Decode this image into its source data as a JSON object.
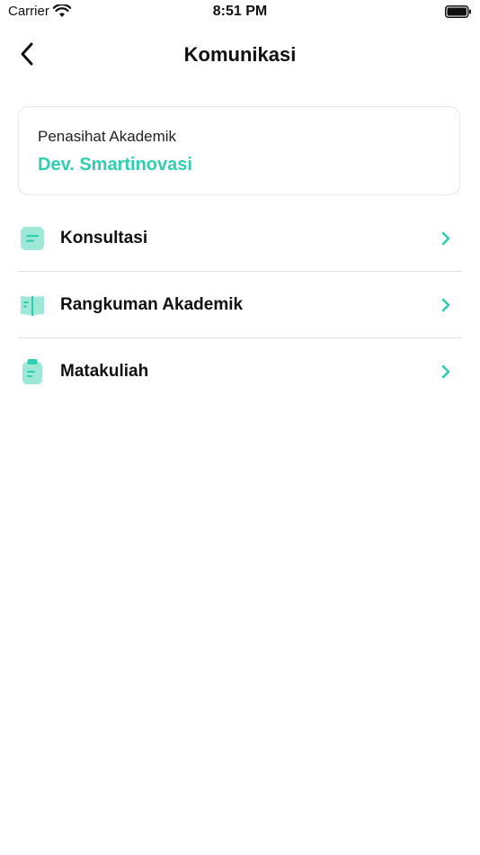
{
  "status_bar": {
    "carrier": "Carrier",
    "time": "8:51 PM",
    "icons": [
      "wifi-icon",
      "battery-icon"
    ]
  },
  "header": {
    "title": "Komunikasi",
    "back_icon": "chevron-left-icon"
  },
  "advisor_card": {
    "label": "Penasihat Akademik",
    "name": "Dev. Smartinovasi"
  },
  "menu": {
    "items": [
      {
        "label": "Konsultasi",
        "icon": "chat-icon"
      },
      {
        "label": "Rangkuman Akademik",
        "icon": "book-icon"
      },
      {
        "label": "Matakuliah",
        "icon": "clipboard-icon"
      }
    ]
  },
  "colors": {
    "accent": "#2ecfb0",
    "icon_fill": "#9ee8d8",
    "divider": "#e2e2e2"
  }
}
